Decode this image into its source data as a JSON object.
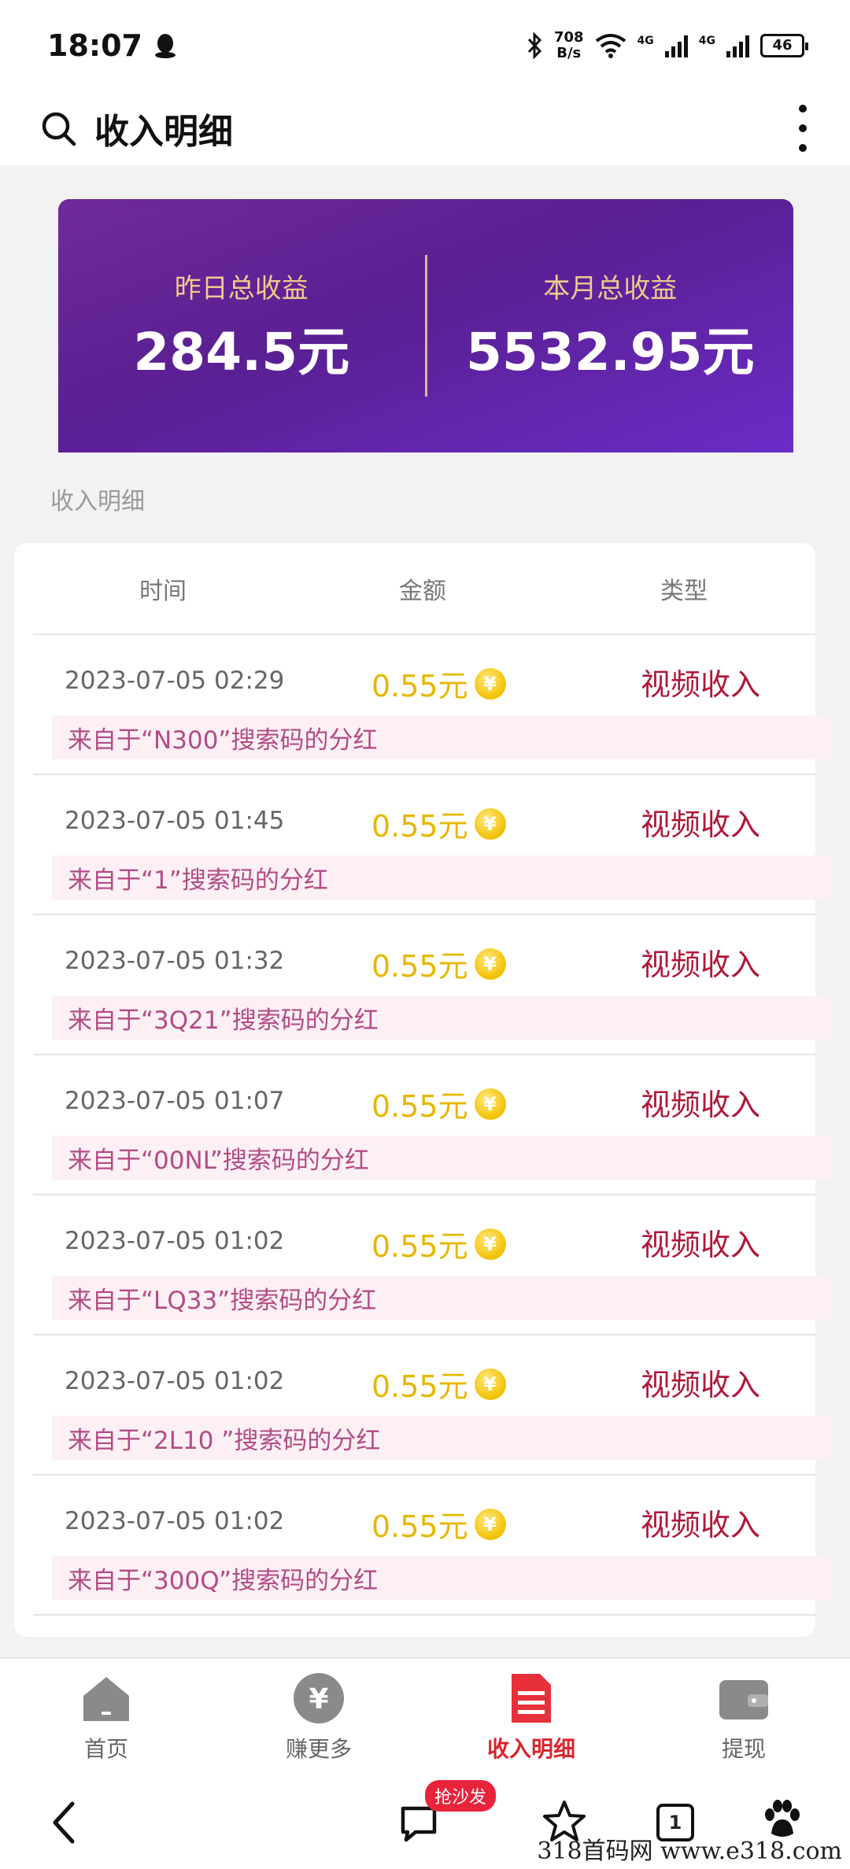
{
  "status_bar": {
    "time": "18:07",
    "net_speed_value": "708",
    "net_speed_unit": "B/s",
    "signal_label_1": "4G",
    "signal_label_2": "4G",
    "battery": "46"
  },
  "header": {
    "title": "收入明细"
  },
  "summary": {
    "yesterday_label": "昨日总收益",
    "yesterday_value": "284.5元",
    "month_label": "本月总收益",
    "month_value": "5532.95元"
  },
  "section_label": "收入明细",
  "table": {
    "columns": [
      "时间",
      "金额",
      "类型"
    ],
    "rows": [
      {
        "time": "2023-07-05  02:29",
        "amount": "0.55元",
        "type": "视频收入",
        "source": "来自于“N300”搜索码的分红"
      },
      {
        "time": "2023-07-05 01:45",
        "amount": "0.55元",
        "type": "视频收入",
        "source": "来自于“1”搜索码的分红"
      },
      {
        "time": "2023-07-05 01:32",
        "amount": "0.55元",
        "type": "视频收入",
        "source": "来自于“3Q21”搜索码的分红"
      },
      {
        "time": "2023-07-05 01:07",
        "amount": "0.55元",
        "type": "视频收入",
        "source": "来自于“00NL”搜索码的分红"
      },
      {
        "time": "2023-07-05 01:02",
        "amount": "0.55元",
        "type": "视频收入",
        "source": "来自于“LQ33”搜索码的分红"
      },
      {
        "time": "2023-07-05 01:02",
        "amount": "0.55元",
        "type": "视频收入",
        "source": "来自于“2L10 ”搜索码的分红"
      },
      {
        "time": "2023-07-05 01:02",
        "amount": "0.55元",
        "type": "视频收入",
        "source": "来自于“300Q”搜索码的分红"
      }
    ],
    "coin_symbol": "¥"
  },
  "bottom_nav": [
    {
      "label": "首页",
      "icon": "home-icon"
    },
    {
      "label": "赚更多",
      "icon": "yen-coin-icon"
    },
    {
      "label": "收入明细",
      "icon": "document-list-icon",
      "active": true
    },
    {
      "label": "提现",
      "icon": "wallet-icon"
    }
  ],
  "browser_bar": {
    "badge": "抢沙发",
    "tabs_count": "1"
  },
  "watermark": "318首码网  www.e318.com",
  "colors": {
    "accent_red": "#d7262f",
    "banner_purple": "#5a1f93",
    "gold": "#f0c98a",
    "amount_yellow": "#e6b800"
  }
}
